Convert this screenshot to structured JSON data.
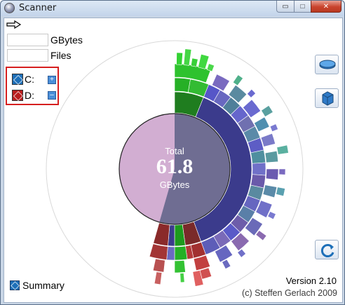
{
  "window": {
    "title": "Scanner",
    "minimize": "▭",
    "maximize": "□",
    "close": "✕"
  },
  "toolbar": {
    "arrow_icon": "arrow-right-icon"
  },
  "stats": {
    "gbytes_label": "GBytes",
    "gbytes_value": "",
    "files_label": "Files",
    "files_value": ""
  },
  "drives": {
    "items": [
      {
        "label": "C:",
        "icon": "drive-c-icon",
        "button": "+"
      },
      {
        "label": "D:",
        "icon": "drive-d-icon",
        "button": "–"
      }
    ]
  },
  "summary": {
    "label": "Summary",
    "icon": "summary-icon"
  },
  "chart": {
    "center_title": "Total",
    "center_value": "61.8",
    "center_unit": "GBytes"
  },
  "footer": {
    "version": "Version 2.10",
    "copyright": "(c) Steffen Gerlach 2009"
  },
  "colors": {
    "highlight": "#d61f1f",
    "free_space": "#d2aed2",
    "used": "#6f6d92",
    "ring_main": "#3c3c8c"
  }
}
